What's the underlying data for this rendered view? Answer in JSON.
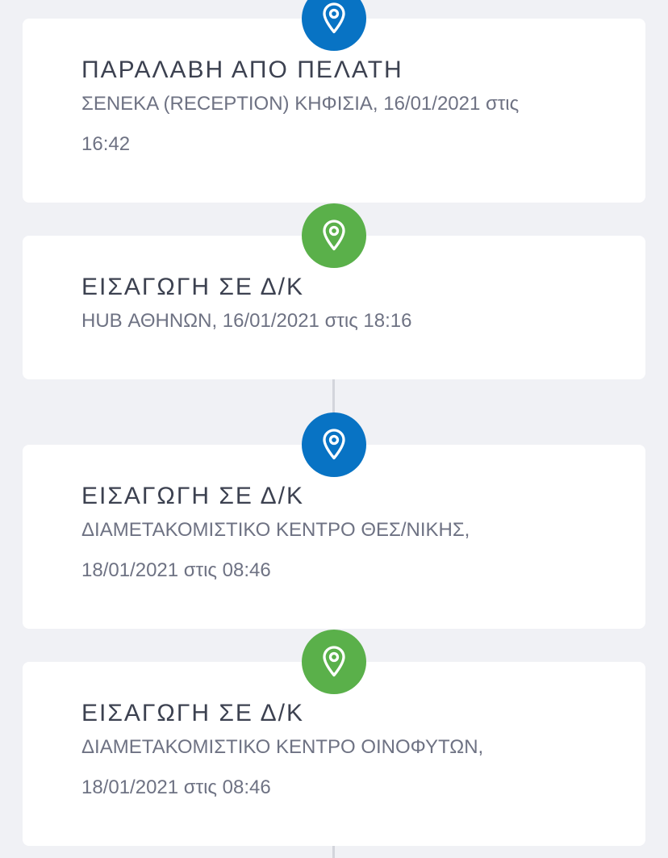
{
  "events": [
    {
      "title": "ΠΑΡΑΛΑΒΗ ΑΠΟ ΠΕΛΑΤΗ",
      "line1": "ΣΕΝΕΚΑ (RECEPTION) ΚΗΦΙΣΙΑ, 16/01/2021 στις",
      "line2": "16:42",
      "pin_color": "#0873c4",
      "icon": "location-pin-icon"
    },
    {
      "title": "ΕΙΣΑΓΩΓΗ ΣΕ Δ/Κ",
      "line1": "HUB ΑΘΗΝΩΝ, 16/01/2021 στις 18:16",
      "line2": "",
      "pin_color": "#5ab04a",
      "icon": "location-pin-icon"
    },
    {
      "title": "ΕΙΣΑΓΩΓΗ ΣΕ Δ/Κ",
      "line1": "ΔΙΑΜΕΤΑΚΟΜΙΣΤΙΚΟ ΚΕΝΤΡΟ ΘΕΣ/ΝΙΚΗΣ,",
      "line2": "18/01/2021 στις 08:46",
      "pin_color": "#0873c4",
      "icon": "location-pin-icon"
    },
    {
      "title": "ΕΙΣΑΓΩΓΗ ΣΕ Δ/Κ",
      "line1": "ΔΙΑΜΕΤΑΚΟΜΙΣΤΙΚΟ ΚΕΝΤΡΟ ΟΙΝΟΦΥΤΩΝ,",
      "line2": "18/01/2021 στις 08:46",
      "pin_color": "#5ab04a",
      "icon": "location-pin-icon"
    }
  ],
  "colors": {
    "background": "#f0f1f5",
    "card": "#ffffff",
    "connector": "#d3d5dc",
    "blue": "#0873c4",
    "green": "#5ab04a"
  }
}
